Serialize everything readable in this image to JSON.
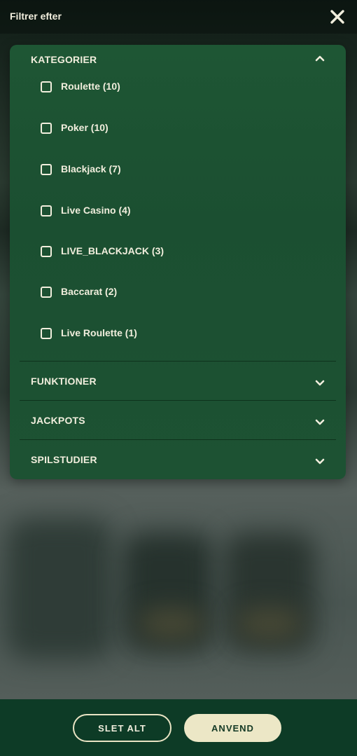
{
  "header": {
    "title": "Filtrer efter"
  },
  "sections": [
    {
      "label": "KATEGORIER",
      "expanded": true,
      "options": [
        {
          "label": "Roulette (10)",
          "checked": false
        },
        {
          "label": "Poker (10)",
          "checked": false
        },
        {
          "label": "Blackjack (7)",
          "checked": false
        },
        {
          "label": "Live Casino (4)",
          "checked": false
        },
        {
          "label": "LIVE_BLACKJACK (3)",
          "checked": false
        },
        {
          "label": "Baccarat (2)",
          "checked": false
        },
        {
          "label": "Live Roulette (1)",
          "checked": false
        }
      ]
    },
    {
      "label": "FUNKTIONER",
      "expanded": false
    },
    {
      "label": "JACKPOTS",
      "expanded": false
    },
    {
      "label": "SPILSTUDIER",
      "expanded": false
    }
  ],
  "footer": {
    "clear_label": "SLET ALT",
    "apply_label": "ANVEND"
  },
  "icons": {
    "close": "close-icon",
    "chevron_up": "chevron-up-icon",
    "chevron_down": "chevron-down-icon"
  },
  "colors": {
    "panel": "#1d5233",
    "text": "#f1eedd",
    "footer": "#0d3b26",
    "apply_button": "#ece7c6"
  }
}
